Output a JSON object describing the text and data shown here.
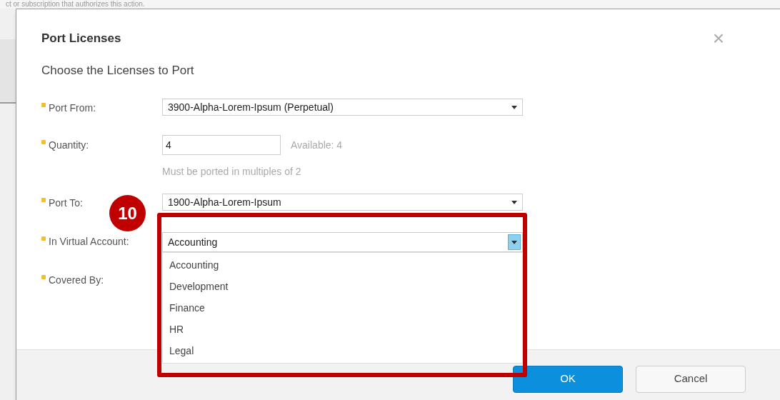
{
  "background_text": "ct or subscription that authorizes this action.",
  "dialog": {
    "title": "Port Licenses",
    "close": "×",
    "subtitle": "Choose the Licenses to Port",
    "fields": [
      {
        "kind": "select",
        "label": "Port From:",
        "required": true,
        "value": "3900-Alpha-Lorem-Ipsum (Perpetual)"
      },
      {
        "kind": "input",
        "label": "Quantity:",
        "required": true,
        "value": "4",
        "note": "Available: 4",
        "hint": "Must be ported in multiples of 2"
      },
      {
        "kind": "select",
        "label": "Port To:",
        "required": true,
        "value": "1900-Alpha-Lorem-Ipsum"
      },
      {
        "kind": "combo",
        "label": "In Virtual Account:",
        "required": true,
        "value": "Accounting",
        "expanded": true,
        "options": [
          "Accounting",
          "Development",
          "Finance",
          "HR",
          "Legal"
        ]
      },
      {
        "kind": "empty",
        "label": "Covered By:",
        "required": true
      }
    ],
    "buttons": [
      {
        "label": "OK",
        "primary": true
      },
      {
        "label": "Cancel",
        "primary": false
      }
    ]
  },
  "annotation": {
    "number": "10"
  }
}
